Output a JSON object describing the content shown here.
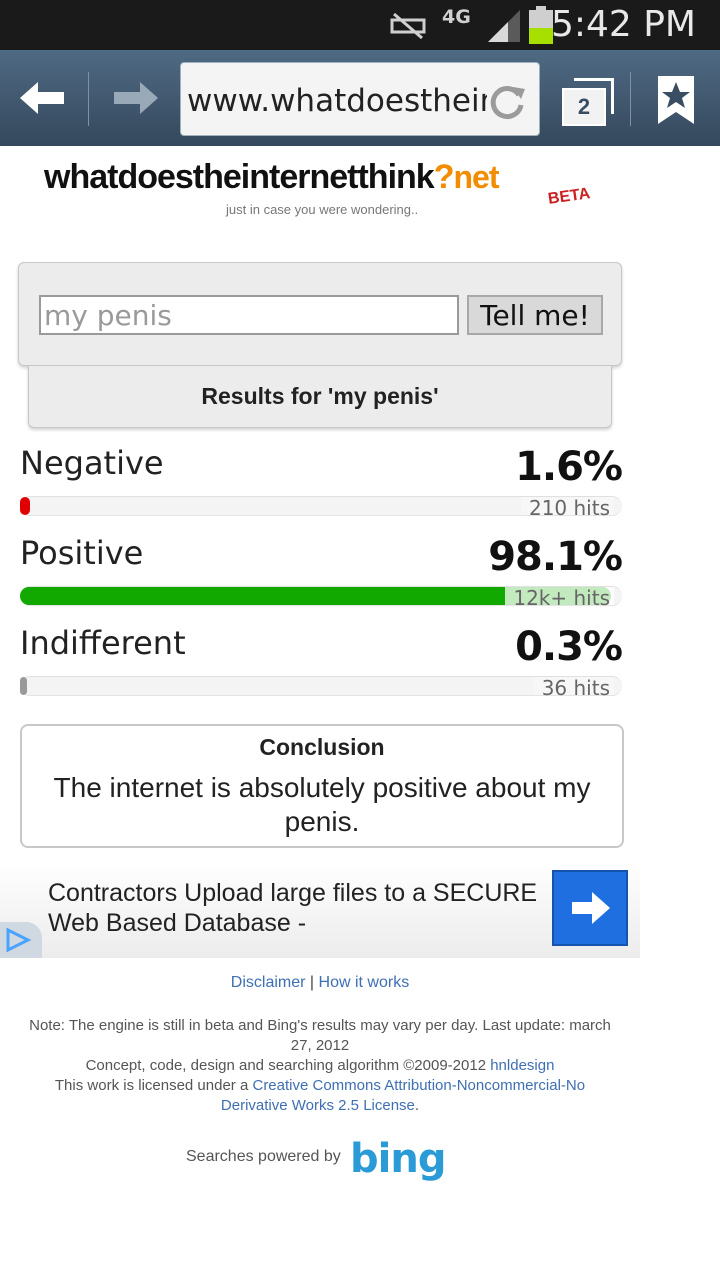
{
  "status_bar": {
    "network": "4G",
    "time": "5:42 PM",
    "icons": [
      "mute-icon",
      "network-4g-icon",
      "signal-icon",
      "battery-icon"
    ]
  },
  "browser": {
    "url": "www.whatdoestheinternetthink.net",
    "tabs_count": "2",
    "icons": [
      "back-arrow-icon",
      "forward-arrow-icon",
      "refresh-icon",
      "tabs-icon",
      "bookmark-star-icon"
    ]
  },
  "logo": {
    "main": "whatdoestheinternetthink",
    "question": "?",
    "net": "net",
    "beta": "BETA",
    "tagline": "just in case you were wondering.."
  },
  "search": {
    "value": "my penis",
    "button_label": "Tell me!"
  },
  "results": {
    "header": "Results for 'my penis'",
    "items": [
      {
        "label": "Negative",
        "percent": "1.6%",
        "hits": "210 hits",
        "fill": 0.016,
        "color": "#e00000"
      },
      {
        "label": "Positive",
        "percent": "98.1%",
        "hits": "12k+ hits",
        "fill": 0.981,
        "color": "#11a800"
      },
      {
        "label": "Indifferent",
        "percent": "0.3%",
        "hits": "36 hits",
        "fill": 0.003,
        "color": "#9a9a9a"
      }
    ]
  },
  "conclusion": {
    "title": "Conclusion",
    "text": "The internet is absolutely positive about my penis."
  },
  "ad": {
    "text": "Contractors Upload large files to a SECURE Web Based Database -",
    "icons": [
      "arrow-right-icon",
      "adchoices-icon"
    ]
  },
  "footer": {
    "disclaimer": "Disclaimer",
    "separator": "|",
    "how_it_works": "How it works",
    "note": "Note: The engine is still in beta and Bing's results may vary per day. Last update: march 27, 2012",
    "credits_prefix": "Concept, code, design and searching algorithm ©2009-2012",
    "credits_link": "hnldesign",
    "license_prefix": "This work is licensed under a",
    "license_link": "Creative Commons Attribution-Noncommercial-No Derivative Works 2.5 License",
    "license_suffix": ".",
    "powered_by": "Searches powered by",
    "bing": "bing"
  },
  "colors": {
    "negative": "#e00000",
    "positive": "#11a800",
    "link": "#3f6fb3",
    "logo_accent": "#f28c00",
    "ad_button": "#1f6fe0"
  }
}
